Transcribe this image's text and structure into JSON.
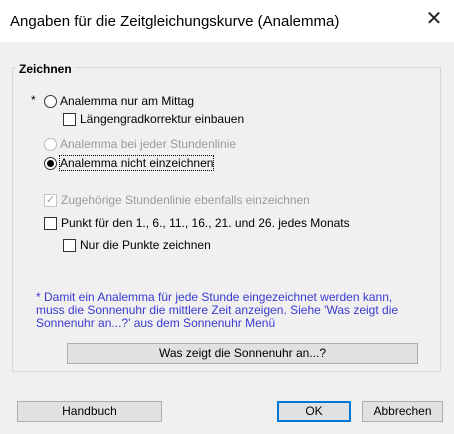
{
  "window": {
    "title": "Angaben für die Zeitgleichungskurve (Analemma)",
    "close_glyph": "✕"
  },
  "group": {
    "label": "Zeichnen",
    "star": "*",
    "radio_noon": {
      "label": "Analemma nur am Mittag",
      "checked": false,
      "enabled": true
    },
    "check_longitude": {
      "label": "Längengradkorrektur einbauen",
      "checked": false,
      "enabled": true
    },
    "radio_each_hour": {
      "label": "Analemma bei jeder Stundenlinie",
      "checked": false,
      "enabled": false
    },
    "radio_none": {
      "label": "Analemma nicht einzeichnen",
      "checked": true,
      "enabled": true
    },
    "check_hourline": {
      "label": "Zugehörige Stundenlinie ebenfalls einzeichnen",
      "checked": true,
      "enabled": false
    },
    "check_points": {
      "label": "Punkt für den 1., 6., 11., 16., 21. und 26. jedes Monats",
      "checked": false,
      "enabled": true
    },
    "check_only_points": {
      "label": "Nur die Punkte zeichnen",
      "checked": false,
      "enabled": true
    },
    "note": "* Damit ein Analemma für jede Stunde eingezeichnet werden kann, muss die Sonnenuhr die mittlere Zeit anzeigen. Siehe 'Was zeigt die Sonnenuhr an...?' aus dem Sonnenuhr Menü",
    "what_button": "Was zeigt die Sonnenuhr an...?"
  },
  "buttons": {
    "manual": "Handbuch",
    "ok": "OK",
    "cancel": "Abbrechen"
  },
  "colors": {
    "note_text": "#3a3ad0",
    "default_button_border": "#0078d7",
    "background": "#f0f0f0"
  }
}
